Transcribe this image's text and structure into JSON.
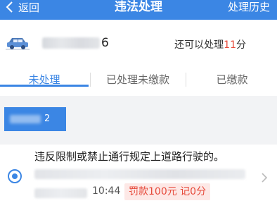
{
  "header": {
    "back_label": "返回",
    "title": "违法处理",
    "history_label": "处理历史"
  },
  "vehicle": {
    "plate_suffix": "6",
    "remaining_prefix": "还可以处理",
    "remaining_count": "11",
    "remaining_suffix": "分"
  },
  "tabs": [
    {
      "label": "未处理"
    },
    {
      "label": "已处理未缴款"
    },
    {
      "label": "已缴款"
    }
  ],
  "group_tag": {
    "suffix": "2"
  },
  "violation": {
    "reason": "违反限制或禁止通行规定上道路行驶的。",
    "time": "10:44",
    "penalty": "罚款100元  记0分"
  },
  "colors": {
    "primary": "#3b86e4",
    "accent": "#e64a3b"
  },
  "icons": {
    "back": "chevron-left-icon",
    "car": "car-icon",
    "more": "chevron-right-icon"
  }
}
